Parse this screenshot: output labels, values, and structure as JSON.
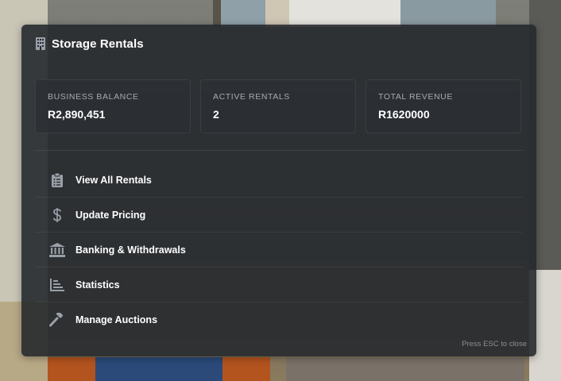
{
  "header": {
    "title": "Storage Rentals",
    "icon": "building-icon"
  },
  "stats": [
    {
      "label": "Business Balance",
      "value": "R2,890,451"
    },
    {
      "label": "Active Rentals",
      "value": "2"
    },
    {
      "label": "Total Revenue",
      "value": "R1620000"
    }
  ],
  "menu": [
    {
      "label": "View All Rentals",
      "icon": "clipboard-list-icon"
    },
    {
      "label": "Update Pricing",
      "icon": "dollar-sign-icon"
    },
    {
      "label": "Banking & Withdrawals",
      "icon": "bank-icon"
    },
    {
      "label": "Statistics",
      "icon": "chart-icon"
    },
    {
      "label": "Manage Auctions",
      "icon": "gavel-icon"
    }
  ],
  "footer": {
    "hint": "Press ESC to close"
  },
  "colors": {
    "panel_bg": "#26292e",
    "text": "#ffffff",
    "muted": "#a6abb2",
    "icon": "#9aa0a8"
  }
}
